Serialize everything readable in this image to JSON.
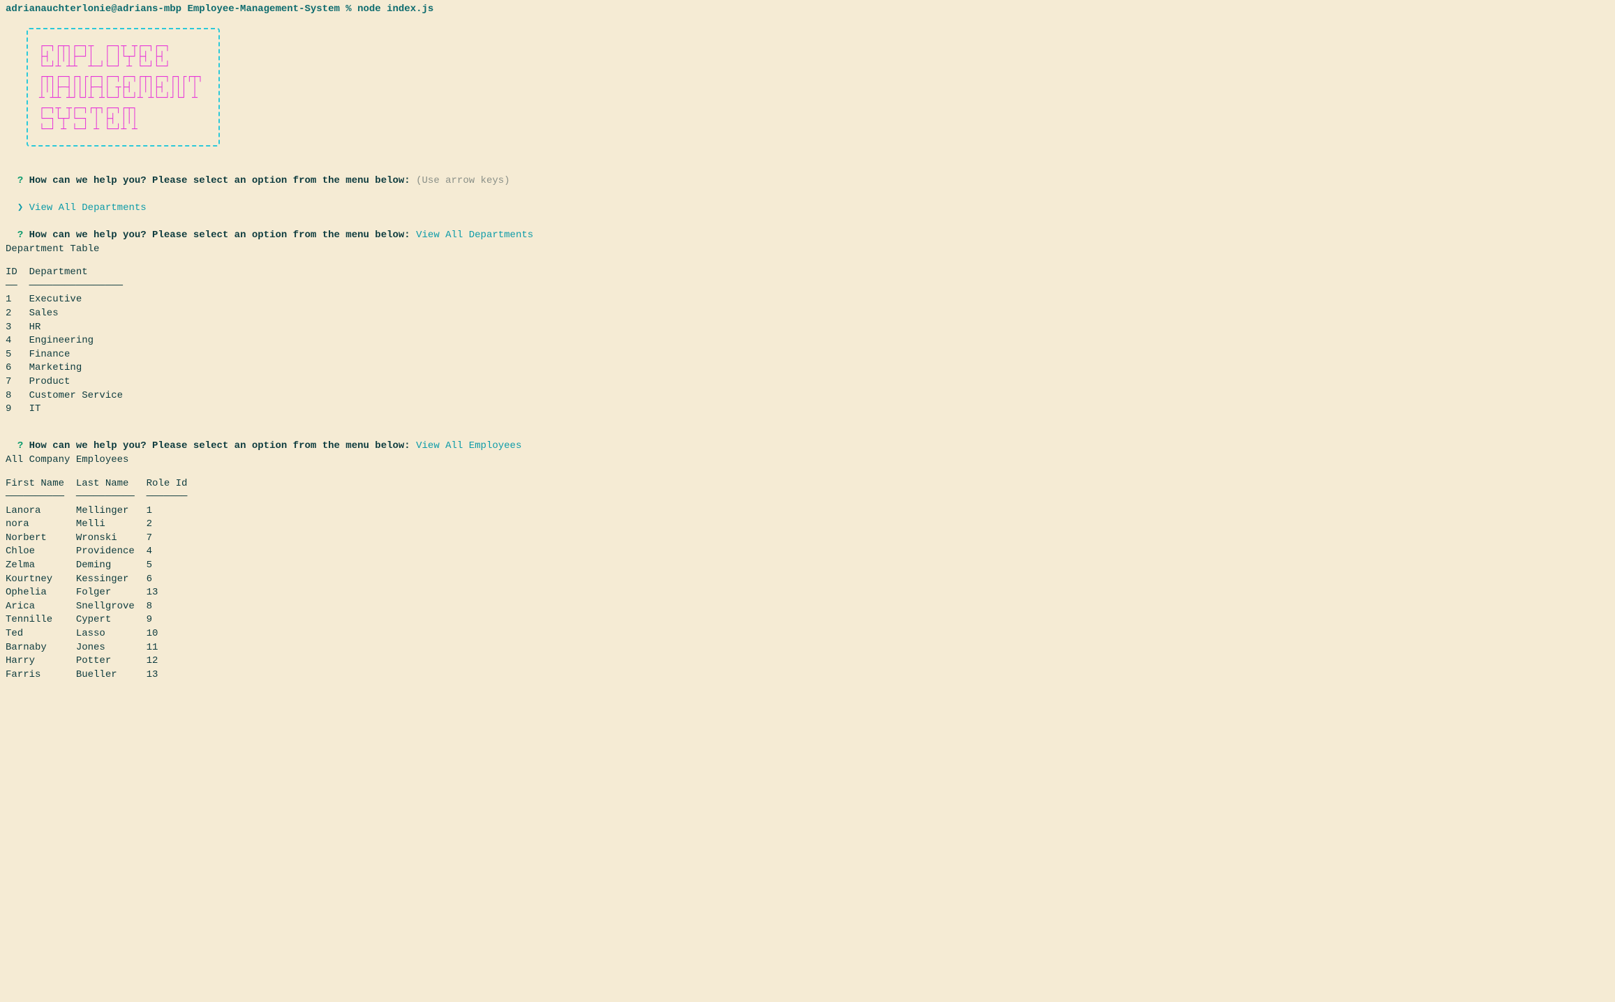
{
  "prompt": "adrianauchterlonie@adrians-mbp Employee-Management-System % node index.js",
  "ascii_art": "┌─┐┌┬┐┌─┐┬  ┌─┐┬ ┬┌─┐┌─┐\n├┤ │││├─┘│  │ │└┬┘├┤ ├┤ \n└─┘┴ ┴┴  ┴─┘└─┘ ┴ └─┘└─┘\n┌┬┐┌─┐┌┐┌┌─┐┌─┐┌─┐┌┬┐┌─┐┌┐┌┌┬┐\n│││├─┤│││├─┤│ ┬├┤ │││├┤ │││ │ \n┴ ┴┴ ┴┘└┘┴ ┴└─┘└─┘┴ ┴└─┘┘└┘ ┴ \n┌─┐┬ ┬┌─┐┌┬┐┌─┐┌┬┐\n└─┐└┬┘└─┐ │ ├┤ │││\n└─┘ ┴ └─┘ ┴ └─┘┴ ┴",
  "q_mark": "?",
  "pointer": "❯",
  "prompt_question": " How can we help you? Please select an option from the menu below: ",
  "hint": "(Use arrow keys)",
  "option_view_depts": " View All Departments",
  "selected_view_depts": "View All Departments",
  "dept_table_title": "Department Table",
  "dept_header": "ID  Department      ",
  "dept_divider": "──  ────────────────",
  "departments": "1   Executive\n2   Sales\n3   HR\n4   Engineering\n5   Finance\n6   Marketing\n7   Product\n8   Customer Service\n9   IT",
  "selected_view_emps": "View All Employees",
  "emp_table_title": "All Company Employees",
  "emp_header": "First Name  Last Name   Role Id",
  "emp_divider": "──────────  ──────────  ───────",
  "employees": "Lanora      Mellinger   1\nnora        Melli       2\nNorbert     Wronski     7\nChloe       Providence  4\nZelma       Deming      5\nKourtney    Kessinger   6\nOphelia     Folger      13\nArica       Snellgrove  8\nTennille    Cypert      9\nTed         Lasso       10\nBarnaby     Jones       11\nHarry       Potter      12\nFarris      Bueller     13"
}
